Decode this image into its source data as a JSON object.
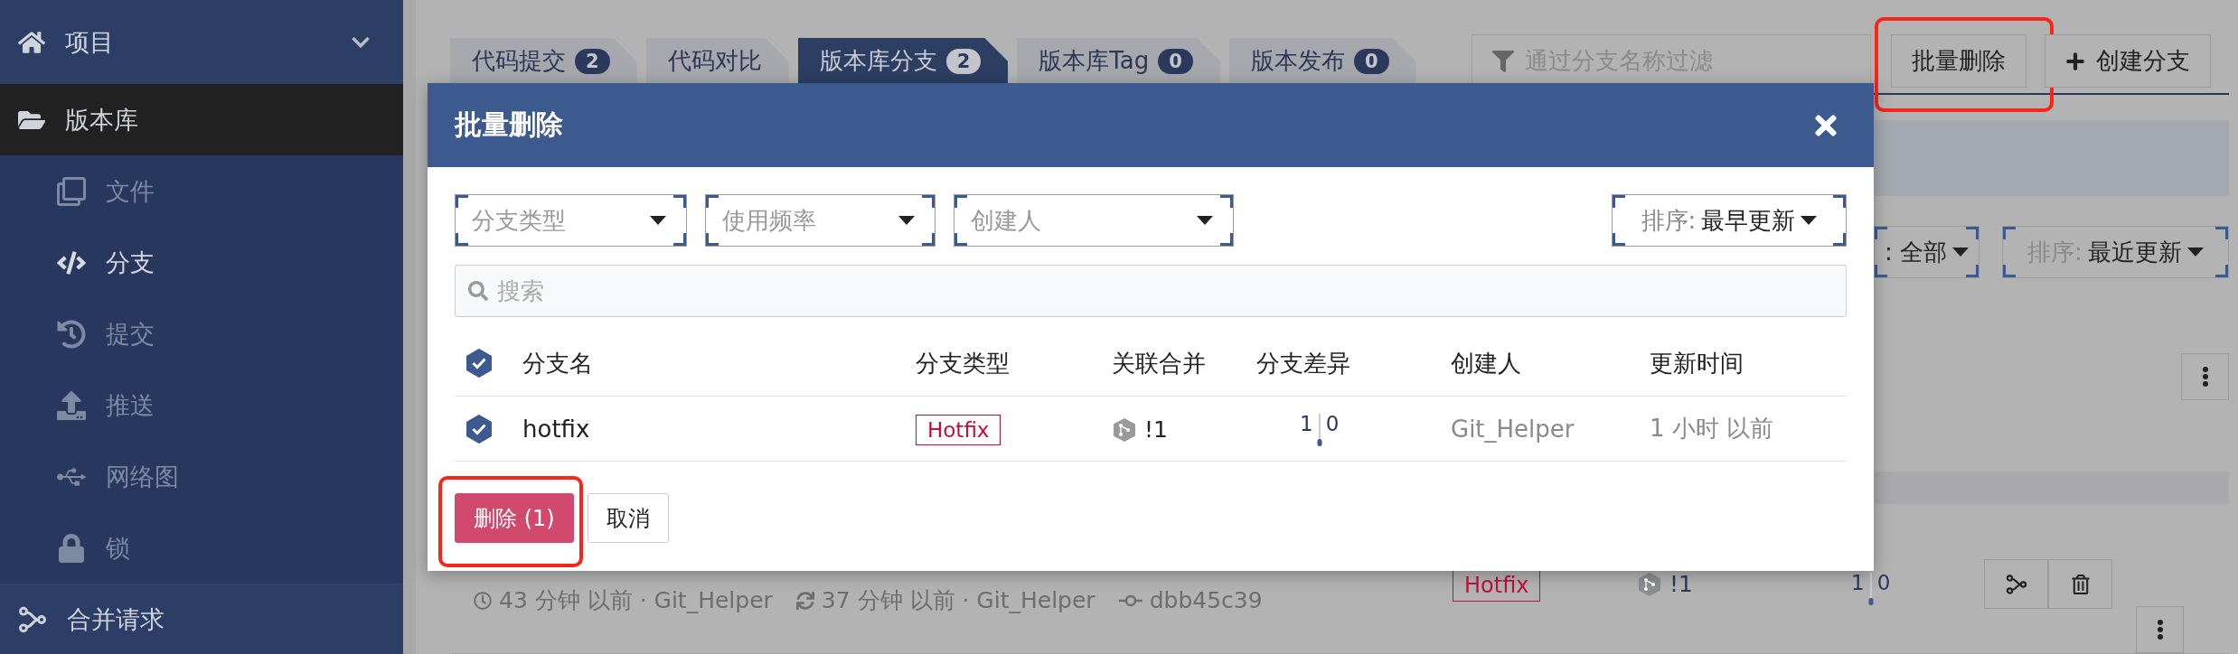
{
  "sidebar": {
    "items": [
      {
        "label": "项目",
        "kind": "group",
        "selected": false
      },
      {
        "label": "版本库",
        "kind": "section",
        "selected": true
      },
      {
        "label": "文件",
        "kind": "sub",
        "selected": false
      },
      {
        "label": "分支",
        "kind": "sub",
        "selected": true
      },
      {
        "label": "提交",
        "kind": "sub",
        "selected": false
      },
      {
        "label": "推送",
        "kind": "sub",
        "selected": false
      },
      {
        "label": "网络图",
        "kind": "sub",
        "selected": false
      },
      {
        "label": "锁",
        "kind": "sub",
        "selected": false
      },
      {
        "label": "合并请求",
        "kind": "section",
        "selected": false
      }
    ]
  },
  "tabs": [
    {
      "label": "代码提交",
      "badge": "2",
      "selected": false
    },
    {
      "label": "代码对比",
      "selected": false
    },
    {
      "label": "版本库分支",
      "badge": "2",
      "selected": true
    },
    {
      "label": "版本库Tag",
      "badge": "0",
      "selected": false
    },
    {
      "label": "版本发布",
      "badge": "0",
      "selected": false
    }
  ],
  "toolbar": {
    "filter": {
      "placeholder": "通过分支名称过滤"
    },
    "buttons": [
      {
        "label": "批量删除",
        "kind": "plain",
        "highlighted": true
      },
      {
        "label": "创建分支",
        "kind": "add",
        "highlighted": false
      }
    ]
  },
  "side_controls": {
    "filter_value": ": 全部",
    "sort": {
      "label": "排序:",
      "value": "最近更新"
    }
  },
  "branch_row": {
    "created": "43 分钟 以前 · Git_Helper",
    "updated": "37 分钟 以前 · Git_Helper",
    "commit": "dbb45c39",
    "type": "Hotfix",
    "merge": "!1",
    "ahead": "1",
    "behind": "0"
  },
  "modal": {
    "title": "批量删除",
    "filters": [
      {
        "placeholder": "分支类型"
      },
      {
        "placeholder": "使用频率"
      },
      {
        "placeholder": "创建人"
      }
    ],
    "sort": {
      "label": "排序:",
      "value": "最早更新"
    },
    "search": {
      "placeholder": "搜索"
    },
    "table": {
      "all_checked": true,
      "columns": [
        "分支名",
        "分支类型",
        "关联合并",
        "分支差异",
        "创建人",
        "更新时间"
      ],
      "rows": [
        {
          "checked": true,
          "name": "hotfix",
          "type": "Hotfix",
          "merge": "!1",
          "ahead": "1",
          "behind": "0",
          "creator": "Git_Helper",
          "updated": "1 小时 以前"
        }
      ]
    },
    "buttons": [
      {
        "label": "删除 (1)",
        "kind": "danger",
        "highlighted": true
      },
      {
        "label": "取消",
        "kind": "plain",
        "highlighted": false
      }
    ]
  }
}
